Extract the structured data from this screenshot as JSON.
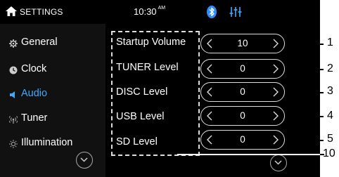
{
  "header": {
    "title": "SETTINGS",
    "time": "10:30",
    "ampm": "AM",
    "icons": [
      "home-icon",
      "bluetooth-icon",
      "equalizer-icon"
    ],
    "accent_color": "#3fa9ff"
  },
  "sidebar": {
    "items": [
      {
        "label": "General",
        "icon": "gear-icon"
      },
      {
        "label": "Clock",
        "icon": "clock-icon"
      },
      {
        "label": "Audio",
        "icon": "speaker-icon",
        "active": true
      },
      {
        "label": "Tuner",
        "icon": "antenna-icon"
      },
      {
        "label": "Illumination",
        "icon": "sun-icon"
      }
    ]
  },
  "settings": [
    {
      "label": "Startup Volume",
      "value": "10"
    },
    {
      "label": "TUNER Level",
      "value": "0"
    },
    {
      "label": "DISC Level",
      "value": "0"
    },
    {
      "label": "USB Level",
      "value": "0"
    },
    {
      "label": "SD Level",
      "value": "0"
    }
  ],
  "callouts": [
    "1",
    "2",
    "3",
    "4",
    "5",
    "10"
  ]
}
